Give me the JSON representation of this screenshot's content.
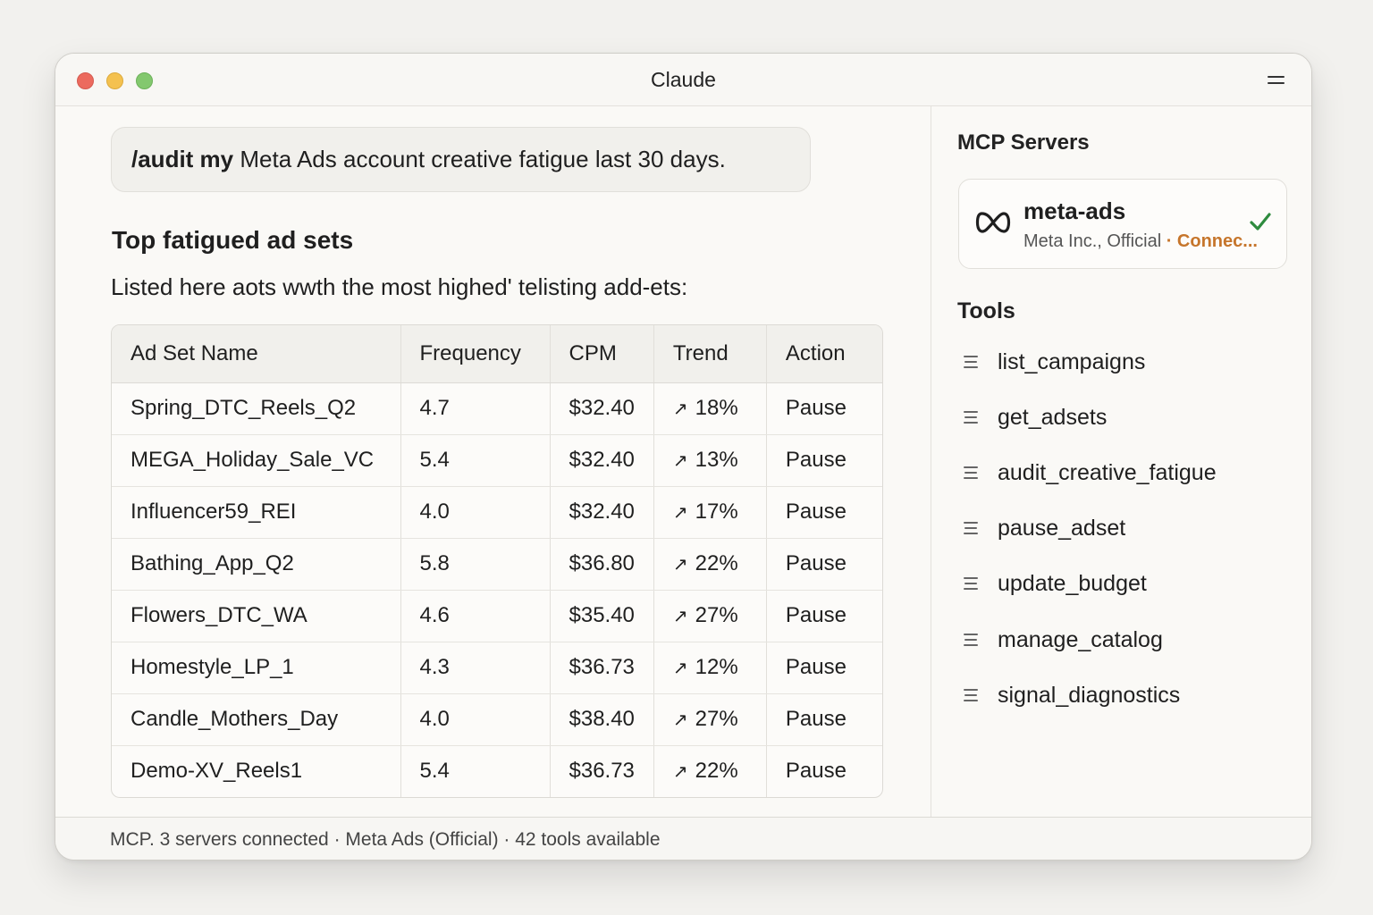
{
  "window": {
    "title": "Claude"
  },
  "chat": {
    "prompt_command": "/audit my",
    "prompt_rest": " Meta Ads account creative fatigue last 30 days.",
    "section_title": "Top fatigued ad sets",
    "description": "Listed here aots wwth the most highed' telisting add-ets:"
  },
  "table": {
    "columns": [
      "Ad Set Name",
      "Frequency",
      "CPM",
      "Trend",
      "Action"
    ],
    "trend_icon": "arrow-up-right-icon",
    "rows": [
      {
        "name": "Spring_DTC_Reels_Q2",
        "frequency": "4.7",
        "cpm": "$32.40",
        "trend": "18%",
        "action": "Pause"
      },
      {
        "name": "MEGA_Holiday_Sale_VC",
        "frequency": "5.4",
        "cpm": "$32.40",
        "trend": "13%",
        "action": "Pause"
      },
      {
        "name": "Influencer59_REI",
        "frequency": "4.0",
        "cpm": "$32.40",
        "trend": "17%",
        "action": "Pause"
      },
      {
        "name": "Bathing_App_Q2",
        "frequency": "5.8",
        "cpm": "$36.80",
        "trend": "22%",
        "action": "Pause"
      },
      {
        "name": "Flowers_DTC_WA",
        "frequency": "4.6",
        "cpm": "$35.40",
        "trend": "27%",
        "action": "Pause"
      },
      {
        "name": "Homestyle_LP_1",
        "frequency": "4.3",
        "cpm": "$36.73",
        "trend": "12%",
        "action": "Pause"
      },
      {
        "name": "Candle_Mothers_Day",
        "frequency": "4.0",
        "cpm": "$38.40",
        "trend": "27%",
        "action": "Pause"
      },
      {
        "name": "Demo-XV_Reels1",
        "frequency": "5.4",
        "cpm": "$36.73",
        "trend": "22%",
        "action": "Pause"
      }
    ]
  },
  "sidebar": {
    "mcp_title": "MCP Servers",
    "server": {
      "name": "meta-ads",
      "publisher": "Meta Inc., Official",
      "separator": " · ",
      "status": "Connec...",
      "icon": "meta-infinity-icon",
      "status_icon": "checkmark-icon"
    },
    "tools_title": "Tools",
    "tools": [
      "list_campaigns",
      "get_adsets",
      "audit_creative_fatigue",
      "pause_adset",
      "update_budget",
      "manage_catalog",
      "signal_diagnostics"
    ]
  },
  "footer": {
    "status": "MCP. 3 servers connected · Meta Ads (Official) · 42 tools available"
  },
  "colors": {
    "accent_status": "#c6752b",
    "check_green": "#2e8b3e",
    "traffic_red": "#ec6a5e",
    "traffic_yellow": "#f4c14f",
    "traffic_green": "#83c86e"
  }
}
